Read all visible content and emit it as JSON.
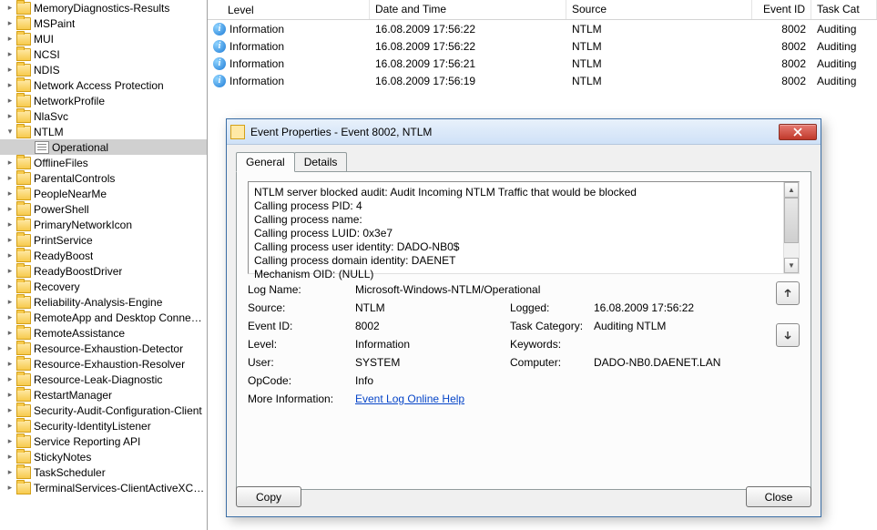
{
  "tree": {
    "items": [
      "MemoryDiagnostics-Results",
      "MSPaint",
      "MUI",
      "NCSI",
      "NDIS",
      "Network Access Protection",
      "NetworkProfile",
      "NlaSvc",
      "NTLM",
      "OfflineFiles",
      "ParentalControls",
      "PeopleNearMe",
      "PowerShell",
      "PrimaryNetworkIcon",
      "PrintService",
      "ReadyBoost",
      "ReadyBoostDriver",
      "Recovery",
      "Reliability-Analysis-Engine",
      "RemoteApp and Desktop Connectio",
      "RemoteAssistance",
      "Resource-Exhaustion-Detector",
      "Resource-Exhaustion-Resolver",
      "Resource-Leak-Diagnostic",
      "RestartManager",
      "Security-Audit-Configuration-Client",
      "Security-IdentityListener",
      "Service Reporting API",
      "StickyNotes",
      "TaskScheduler",
      "TerminalServices-ClientActiveXCore"
    ],
    "expanded_index": 8,
    "child_label": "Operational"
  },
  "list": {
    "headers": [
      "Level",
      "Date and Time",
      "Source",
      "Event ID",
      "Task Cat"
    ],
    "rows": [
      {
        "level": "Information",
        "date": "16.08.2009 17:56:22",
        "source": "NTLM",
        "eventid": "8002",
        "taskcat": "Auditing"
      },
      {
        "level": "Information",
        "date": "16.08.2009 17:56:22",
        "source": "NTLM",
        "eventid": "8002",
        "taskcat": "Auditing"
      },
      {
        "level": "Information",
        "date": "16.08.2009 17:56:21",
        "source": "NTLM",
        "eventid": "8002",
        "taskcat": "Auditing"
      },
      {
        "level": "Information",
        "date": "16.08.2009 17:56:19",
        "source": "NTLM",
        "eventid": "8002",
        "taskcat": "Auditing"
      }
    ]
  },
  "dialog": {
    "title": "Event Properties - Event 8002, NTLM",
    "tabs": {
      "general": "General",
      "details": "Details"
    },
    "description_lines": [
      "NTLM server blocked audit: Audit Incoming NTLM Traffic that would be blocked",
      "Calling process PID: 4",
      "Calling process name:",
      "Calling process LUID: 0x3e7",
      "Calling process user identity: DADO-NB0$",
      "Calling process domain identity: DAENET",
      "Mechanism OID: (NULL)"
    ],
    "props": {
      "logname_label": "Log Name:",
      "logname_value": "Microsoft-Windows-NTLM/Operational",
      "source_label": "Source:",
      "source_value": "NTLM",
      "logged_label": "Logged:",
      "logged_value": "16.08.2009 17:56:22",
      "eventid_label": "Event ID:",
      "eventid_value": "8002",
      "taskcat_label": "Task Category:",
      "taskcat_value": "Auditing NTLM",
      "level_label": "Level:",
      "level_value": "Information",
      "keywords_label": "Keywords:",
      "keywords_value": "",
      "user_label": "User:",
      "user_value": "SYSTEM",
      "computer_label": "Computer:",
      "computer_value": "DADO-NB0.DAENET.LAN",
      "opcode_label": "OpCode:",
      "opcode_value": "Info",
      "moreinfo_label": "More Information:",
      "moreinfo_link": "Event Log Online Help"
    },
    "buttons": {
      "copy": "Copy",
      "close": "Close"
    }
  }
}
